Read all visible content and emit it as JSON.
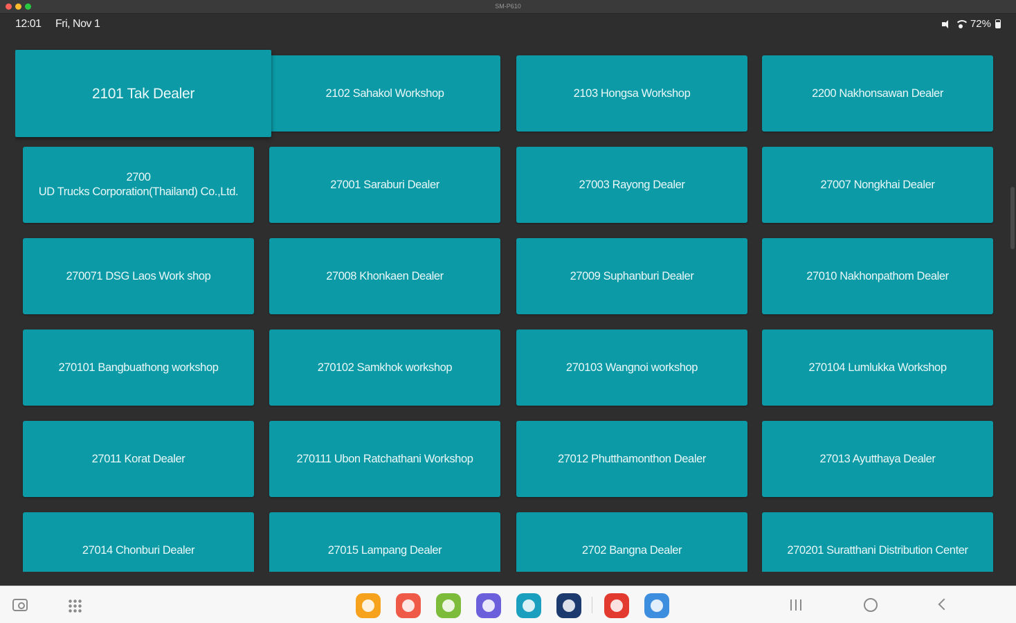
{
  "window": {
    "title": "SM-P610"
  },
  "status_bar": {
    "time": "12:01",
    "date": "Fri, Nov 1",
    "battery": "72%"
  },
  "tiles": [
    [
      "2101 Tak Dealer",
      "2102 Sahakol Workshop",
      "2103 Hongsa Workshop",
      "2200 Nakhonsawan Dealer"
    ],
    [
      "2700\nUD Trucks Corporation(Thailand) Co.,Ltd.",
      "27001 Saraburi Dealer",
      "27003 Rayong Dealer",
      "27007 Nongkhai Dealer"
    ],
    [
      "270071 DSG Laos Work shop",
      "27008 Khonkaen Dealer",
      "27009 Suphanburi Dealer",
      "27010 Nakhonpathom Dealer"
    ],
    [
      "270101 Bangbuathong workshop",
      "270102 Samkhok workshop",
      "270103 Wangnoi workshop",
      "270104 Lumlukka Workshop"
    ],
    [
      "27011 Korat Dealer",
      "270111 Ubon Ratchathani Workshop",
      "27012 Phutthamonthon Dealer",
      "27013 Ayutthaya Dealer"
    ],
    [
      "27014 Chonburi Dealer",
      "27015 Lampang Dealer",
      "2702 Bangna Dealer",
      "270201 Suratthani Distribution Center"
    ]
  ],
  "selected_tile": "2101 Tak Dealer",
  "colors": {
    "tile": "#0b9aa6",
    "background": "#2e2e2e",
    "taskbar": "#f7f7f7"
  },
  "taskbar": {
    "icons": [
      "screen-capture-icon",
      "apps-grid-icon",
      "my-files-icon",
      "contacts-icon",
      "calculator-icon",
      "messages-icon",
      "calendar-icon",
      "settings-icon",
      "app-icon",
      "chrome-icon"
    ],
    "app_colors": [
      "#f6a21d",
      "#ee5a47",
      "#7dbb3a",
      "#6b5fdc",
      "#1a9fbf",
      "#1c3a6e",
      "#e23a2e",
      "#3e8ee0"
    ]
  }
}
